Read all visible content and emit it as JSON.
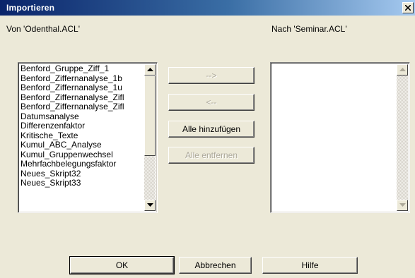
{
  "window": {
    "title": "Importieren"
  },
  "source": {
    "label": "Von 'Odenthal.ACL'",
    "items": [
      "Benford_Gruppe_Ziff_1",
      "Benford_Ziffernanalyse_1b",
      "Benford_Ziffernanalyse_1u",
      "Benford_Ziffernanalyse_Zifl",
      "Benford_Ziffernanalyse_Zifl",
      "Datumsanalyse",
      "Differenzenfaktor",
      "Kritische_Texte",
      "Kumul_ABC_Analyse",
      "Kumul_Gruppenwechsel",
      "Mehrfachbelegungsfaktor",
      "Neues_Skript32",
      "Neues_Skript33"
    ]
  },
  "target": {
    "label": "Nach 'Seminar.ACL'",
    "items": []
  },
  "transfer": {
    "add_label": "-->",
    "remove_label": "<--",
    "add_all_label": "Alle hinzufügen",
    "remove_all_label": "Alle entfernen"
  },
  "footer": {
    "ok_label": "OK",
    "cancel_label": "Abbrechen",
    "help_label": "Hilfe"
  },
  "icons": {
    "close": "close-icon",
    "scroll_up": "arrow-up-icon",
    "scroll_down": "arrow-down-icon"
  }
}
